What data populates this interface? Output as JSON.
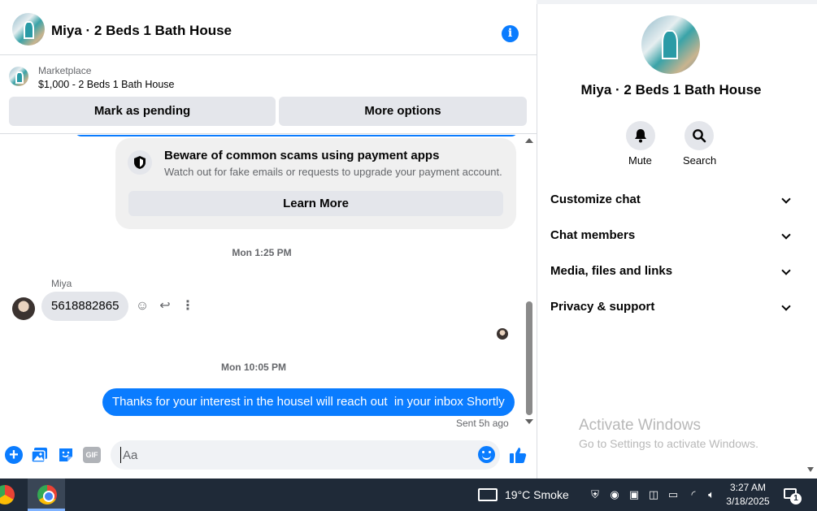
{
  "chat": {
    "title": "Miya · 2 Beds 1 Bath House",
    "marketplace_label": "Marketplace",
    "listing": "$1,000 - 2 Beds 1 Bath House",
    "mark_pending": "Mark as pending",
    "more_options": "More options"
  },
  "scam_notice": {
    "title": "Beware of common scams using payment apps",
    "body": "Watch out for fake emails or requests to upgrade your payment account.",
    "button": "Learn More"
  },
  "messages": {
    "timestamp_1": "Mon 1:25 PM",
    "sender": "Miya",
    "incoming_text": "5618882865",
    "timestamp_2": "Mon 10:05 PM",
    "outgoing_text": "Thanks for your interest in the housel will reach out  in your inbox Shortly",
    "sent_status": "Sent 5h ago"
  },
  "composer": {
    "placeholder": "Aa",
    "gif_label": "GIF"
  },
  "info_panel": {
    "title": "Miya · 2 Beds 1 Bath House",
    "mute_label": "Mute",
    "search_label": "Search",
    "sections": [
      "Customize chat",
      "Chat members",
      "Media, files and links",
      "Privacy & support"
    ]
  },
  "watermark": {
    "line1": "Activate Windows",
    "line2": "Go to Settings to activate Windows."
  },
  "taskbar": {
    "weather": "19°C  Smoke",
    "time": "3:27 AM",
    "date": "3/18/2025",
    "notification_count": "1"
  },
  "colors": {
    "accent": "#0a7cff",
    "taskbar": "#1f2a38",
    "bubble_in": "#e4e6eb"
  }
}
